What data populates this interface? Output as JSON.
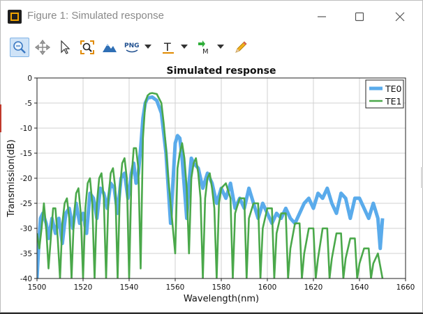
{
  "window": {
    "title": "Figure 1: Simulated response",
    "controls": {
      "minimize": "minimize-icon",
      "maximize": "maximize-icon",
      "close": "close-icon"
    }
  },
  "toolbar": {
    "items": [
      {
        "name": "zoom-tool",
        "icon": "zoom-icon",
        "active": true
      },
      {
        "name": "pan-tool",
        "icon": "pan-icon",
        "active": false
      },
      {
        "name": "select-tool",
        "icon": "pointer-icon",
        "active": false
      },
      {
        "name": "zoom-extents-tool",
        "icon": "zoom-extents-icon",
        "active": false
      },
      {
        "name": "view-3d-tool",
        "icon": "mountain-icon",
        "active": false
      },
      {
        "name": "export-png-tool",
        "icon": "png-icon",
        "label": "PNG",
        "dropdown": true
      },
      {
        "name": "text-tool",
        "icon": "text-t-icon",
        "label": "T",
        "dropdown": true
      },
      {
        "name": "marker-tool",
        "icon": "marker-icon",
        "label": "M",
        "dropdown": true
      },
      {
        "name": "pencil-tool",
        "icon": "pencil-icon",
        "active": false
      }
    ]
  },
  "colors": {
    "te0": "#5aabeb",
    "te1": "#4aa84a",
    "grid": "#d0d0d0",
    "active_tool_bg": "#cfe3f7"
  },
  "chart_data": {
    "type": "line",
    "title": "Simulated response",
    "xlabel": "Wavelength(nm)",
    "ylabel": "Transmission(dB)",
    "xlim": [
      1500,
      1660
    ],
    "ylim": [
      -40,
      0
    ],
    "xticks": [
      "1500",
      "1520",
      "1540",
      "1560",
      "1580",
      "1600",
      "1620",
      "1640",
      "1660"
    ],
    "yticks": [
      "0",
      "-5",
      "-10",
      "-15",
      "-20",
      "-25",
      "-30",
      "-35",
      "-40"
    ],
    "grid": true,
    "legend_position": "top-right",
    "series": [
      {
        "name": "TE0",
        "x": [
          1500,
          1500.8,
          1501.5,
          1502.5,
          1504,
          1505,
          1506.5,
          1508,
          1509.5,
          1511,
          1512.5,
          1514,
          1515.5,
          1517,
          1518.5,
          1520,
          1521.5,
          1523,
          1524.5,
          1526,
          1527.5,
          1529,
          1530.5,
          1532,
          1533.5,
          1535,
          1536.5,
          1538,
          1539.5,
          1541,
          1542,
          1543,
          1544,
          1545,
          1546,
          1547,
          1548,
          1550,
          1552,
          1554,
          1556,
          1557,
          1558,
          1559,
          1560,
          1561,
          1562,
          1563,
          1564,
          1565,
          1566,
          1567,
          1568,
          1570,
          1572,
          1574,
          1576,
          1578,
          1580,
          1582,
          1584,
          1586,
          1588,
          1590,
          1592,
          1594,
          1596,
          1598,
          1600,
          1602,
          1604,
          1606,
          1608,
          1610,
          1612,
          1614,
          1616,
          1618,
          1620,
          1622,
          1624,
          1626,
          1628,
          1630,
          1632,
          1634,
          1636,
          1638,
          1640,
          1642,
          1644,
          1646,
          1648,
          1649,
          1650
        ],
        "y": [
          -40,
          -33,
          -28,
          -27,
          -29,
          -32,
          -28,
          -31,
          -28,
          -33,
          -27,
          -26,
          -30,
          -25,
          -29,
          -27,
          -31,
          -23,
          -24,
          -28,
          -22,
          -23,
          -26,
          -21,
          -22,
          -27,
          -20,
          -19,
          -24,
          -19,
          -17,
          -21,
          -19,
          -14,
          -8,
          -5,
          -4,
          -3.8,
          -4.5,
          -7,
          -15,
          -22,
          -29,
          -21,
          -13,
          -11.5,
          -12,
          -16,
          -22,
          -28,
          -21,
          -16,
          -17,
          -18,
          -22,
          -19,
          -21,
          -25,
          -22,
          -24,
          -21,
          -26,
          -24,
          -26,
          -22,
          -25,
          -28,
          -25,
          -27,
          -29,
          -27,
          -28,
          -26,
          -28,
          -29,
          -27,
          -25,
          -24,
          -26,
          -23,
          -24,
          -22,
          -25,
          -27,
          -23,
          -24,
          -28,
          -24,
          -24,
          -26,
          -28,
          -25,
          -28,
          -34,
          -28
        ]
      },
      {
        "name": "TE1",
        "x": [
          1500,
          1501,
          1502,
          1503,
          1504,
          1505,
          1506,
          1507,
          1508,
          1509,
          1510,
          1511,
          1512,
          1513,
          1514,
          1515,
          1516,
          1517,
          1518,
          1519,
          1520,
          1521,
          1522,
          1523,
          1524,
          1525,
          1526,
          1527,
          1528,
          1529,
          1530,
          1531,
          1532,
          1533,
          1534,
          1535,
          1536,
          1537,
          1538,
          1539,
          1540,
          1541,
          1542,
          1543,
          1544,
          1545,
          1546,
          1547,
          1548,
          1549,
          1550,
          1552,
          1554,
          1555,
          1556,
          1557,
          1558,
          1559,
          1560,
          1561,
          1562,
          1563,
          1564,
          1565,
          1566,
          1567,
          1568,
          1569,
          1570,
          1571,
          1572,
          1573,
          1574,
          1575,
          1576,
          1577,
          1578,
          1579,
          1580,
          1582,
          1584,
          1585,
          1586,
          1588,
          1590,
          1591,
          1592,
          1594,
          1596,
          1597,
          1598,
          1600,
          1602,
          1603,
          1604,
          1606,
          1608,
          1609,
          1610,
          1612,
          1614,
          1615,
          1616,
          1618,
          1620,
          1621,
          1622,
          1624,
          1626,
          1627,
          1628,
          1630,
          1632,
          1633,
          1634,
          1636,
          1638,
          1639,
          1640,
          1642,
          1644,
          1645,
          1646,
          1648,
          1650
        ],
        "y": [
          -31,
          -34,
          -30,
          -25,
          -30,
          -38,
          -32,
          -26,
          -26,
          -32,
          -40,
          -29,
          -25,
          -24,
          -28,
          -40,
          -28,
          -23,
          -22,
          -27,
          -40,
          -26,
          -21,
          -20,
          -25,
          -40,
          -25,
          -20,
          -19,
          -24,
          -40,
          -24,
          -19,
          -18,
          -22,
          -40,
          -22,
          -17,
          -16,
          -20,
          -40,
          -20,
          -14,
          -14,
          -18,
          -38,
          -12,
          -5,
          -3.5,
          -3.1,
          -3,
          -3.2,
          -5,
          -9,
          -14,
          -20,
          -25,
          -30,
          -35,
          -18,
          -15,
          -13,
          -16,
          -22,
          -35,
          -20,
          -17,
          -16,
          -19,
          -24,
          -40,
          -24,
          -20,
          -19,
          -22,
          -26,
          -40,
          -25,
          -22,
          -21,
          -24,
          -40,
          -27,
          -24,
          -24,
          -40,
          -28,
          -25,
          -25,
          -40,
          -30,
          -26,
          -26,
          -40,
          -31,
          -27,
          -27,
          -40,
          -34,
          -29,
          -29,
          -40,
          -35,
          -30,
          -30,
          -40,
          -36,
          -30,
          -30,
          -40,
          -36,
          -31,
          -31,
          -40,
          -36,
          -32,
          -32,
          -40,
          -37,
          -34,
          -34,
          -40,
          -37,
          -35,
          -40
        ]
      }
    ]
  }
}
